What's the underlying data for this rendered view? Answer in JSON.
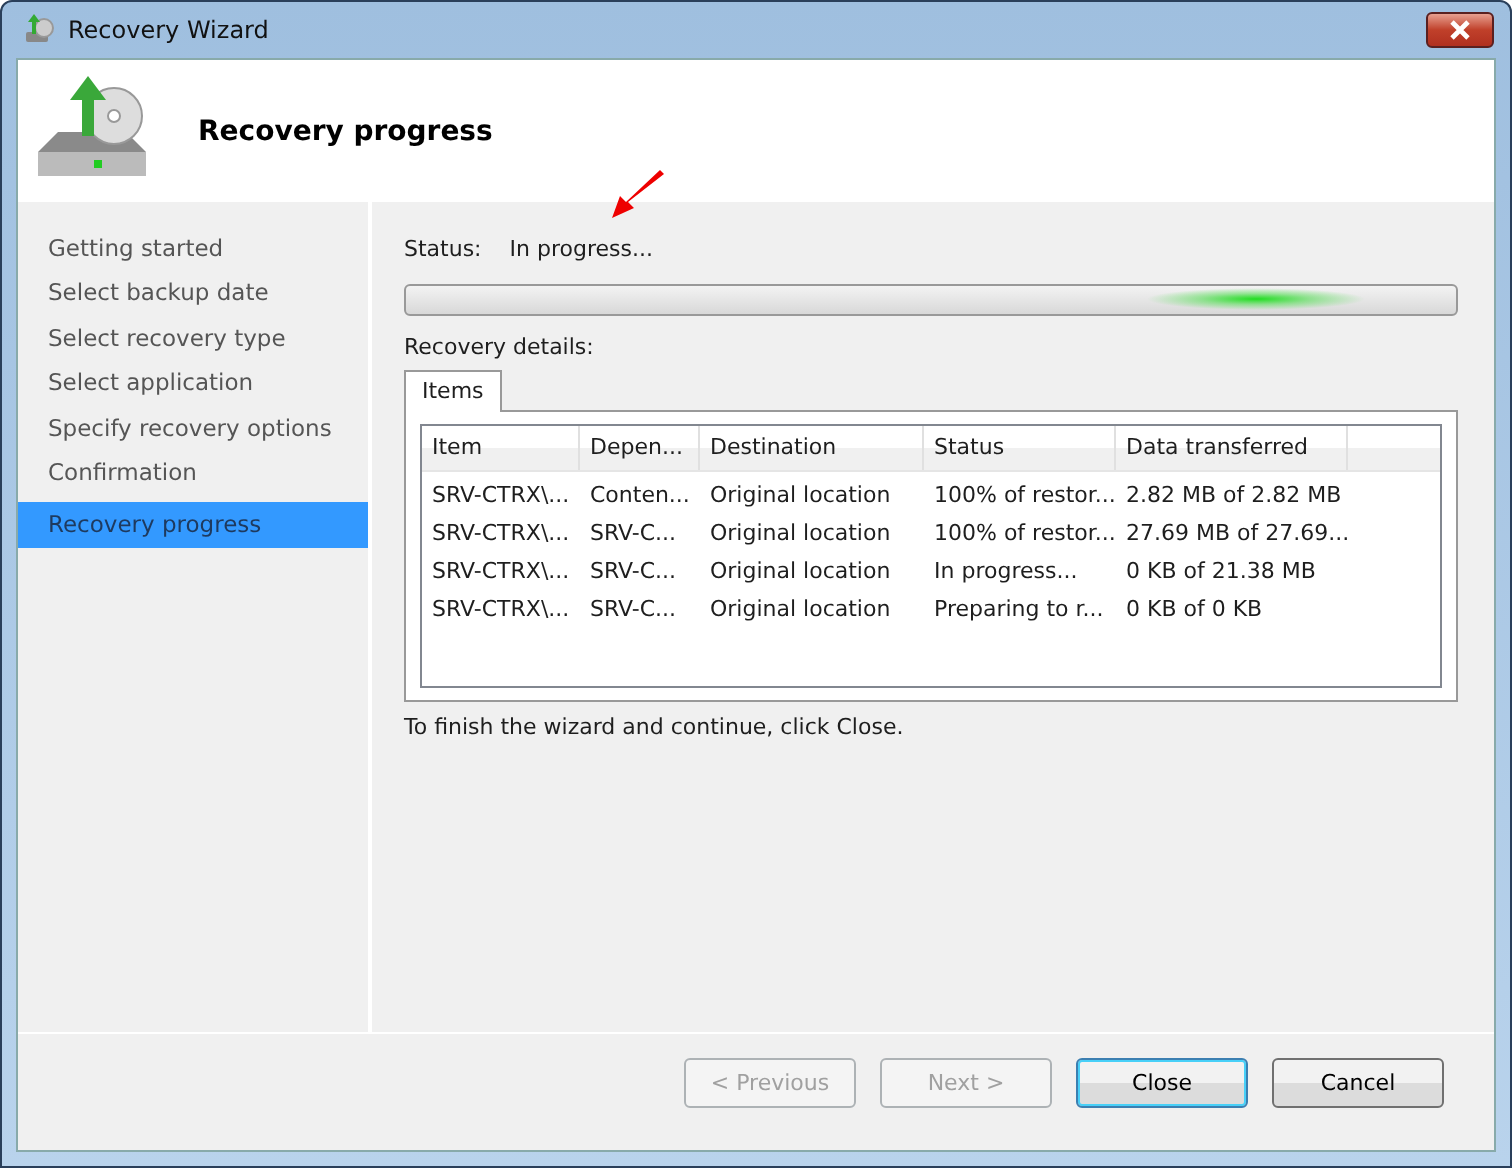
{
  "window": {
    "title": "Recovery Wizard"
  },
  "header": {
    "title": "Recovery progress"
  },
  "sidebar": {
    "items": [
      {
        "label": "Getting started",
        "selected": false
      },
      {
        "label": "Select backup date",
        "selected": false
      },
      {
        "label": "Select recovery type",
        "selected": false
      },
      {
        "label": "Select application",
        "selected": false
      },
      {
        "label": "Specify recovery options",
        "selected": false
      },
      {
        "label": "Confirmation",
        "selected": false
      },
      {
        "label": "Recovery progress",
        "selected": true
      }
    ]
  },
  "status": {
    "label": "Status:",
    "value": "In progress..."
  },
  "progress": {
    "indeterminate": true
  },
  "details_label": "Recovery details:",
  "tabs": [
    {
      "label": "Items",
      "selected": true
    }
  ],
  "table": {
    "columns": [
      "Item",
      "Depen...",
      "Destination",
      "Status",
      "Data transferred"
    ],
    "rows": [
      [
        "SRV-CTRX\\...",
        "Conten...",
        "Original location",
        "100% of restor...",
        "2.82 MB of 2.82 MB"
      ],
      [
        "SRV-CTRX\\...",
        "SRV-C...",
        "Original location",
        "100% of restor...",
        "27.69 MB of 27.69..."
      ],
      [
        "SRV-CTRX\\...",
        "SRV-C...",
        "Original location",
        "In progress...",
        "0 KB of 21.38 MB"
      ],
      [
        "SRV-CTRX\\...",
        "SRV-C...",
        "Original location",
        "Preparing to r...",
        "0 KB of 0 KB"
      ]
    ]
  },
  "hint": "To finish the wizard and continue, click Close.",
  "buttons": [
    {
      "label": "< Previous",
      "disabled": true,
      "default": false
    },
    {
      "label": "Next >",
      "disabled": true,
      "default": false
    },
    {
      "label": "Close",
      "disabled": false,
      "default": true
    },
    {
      "label": "Cancel",
      "disabled": false,
      "default": false
    }
  ]
}
